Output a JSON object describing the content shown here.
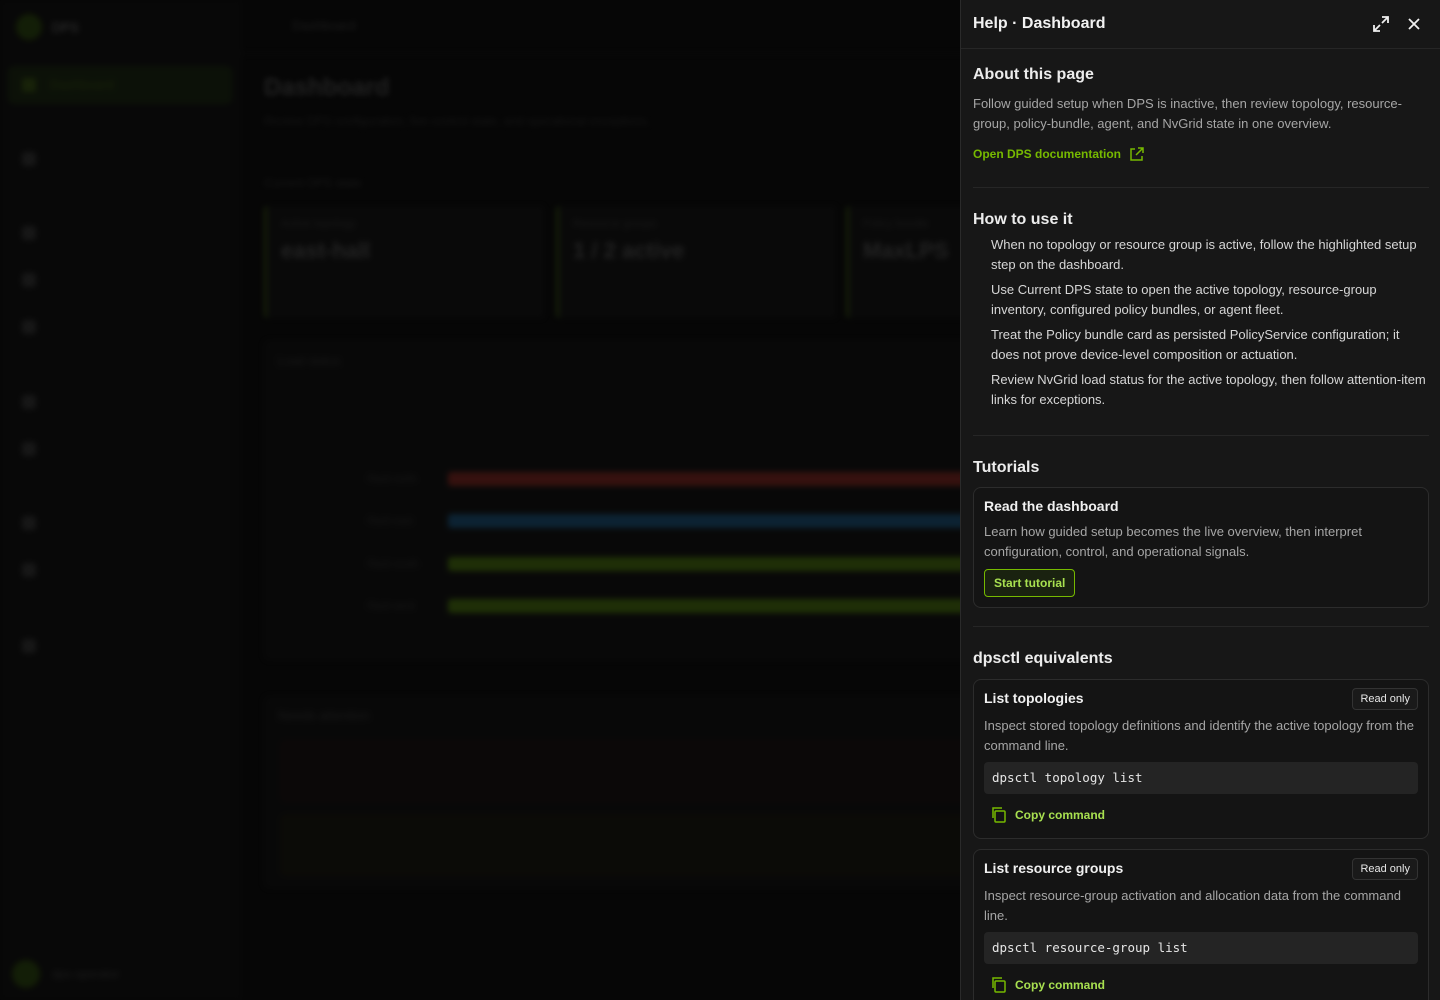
{
  "background": {
    "brand": "DPS",
    "nav_active": "Dashboard",
    "topbar_text": "Dashboard",
    "page_title": "Dashboard",
    "page_subtitle": "Review DPS configuration, live control state, and operational exceptions.",
    "section_label": "Current DPS state",
    "cards": [
      {
        "label": "Active topology",
        "value": "east-hall"
      },
      {
        "label": "Resource groups",
        "value": "1 / 2 active"
      },
      {
        "label": "Policy bundle",
        "value": "MaxLPS"
      }
    ],
    "chart_title": "Load status",
    "bars": [
      {
        "label": "Rack north",
        "color": "#8f2a22"
      },
      {
        "label": "Rack east",
        "color": "#1c5a86"
      },
      {
        "label": "Rack south",
        "color": "#4f7d0e"
      },
      {
        "label": "Rack west",
        "color": "#4f7d0e"
      }
    ],
    "attention_title": "Needs attention",
    "user": "dps operator"
  },
  "panel": {
    "title": "Help · Dashboard",
    "about": {
      "title": "About this page",
      "text": "Follow guided setup when DPS is inactive, then review topology, resource-group, policy-bundle, agent, and NvGrid state in one overview.",
      "link": "Open DPS documentation"
    },
    "how": {
      "title": "How to use it",
      "steps": [
        "When no topology or resource group is active, follow the highlighted setup step on the dashboard.",
        "Use Current DPS state to open the active topology, resource-group inventory, configured policy bundles, or agent fleet.",
        "Treat the Policy bundle card as persisted PolicyService configuration; it does not prove device-level composition or actuation.",
        "Review NvGrid load status for the active topology, then follow attention-item links for exceptions."
      ]
    },
    "tutorials": {
      "title": "Tutorials",
      "card_title": "Read the dashboard",
      "card_text": "Learn how guided setup becomes the live overview, then interpret configuration, control, and operational signals.",
      "button": "Start tutorial"
    },
    "dpsctl": {
      "title": "dpsctl equivalents",
      "commands": [
        {
          "title": "List topologies",
          "badge": "Read only",
          "text": "Inspect stored topology definitions and identify the active topology from the command line.",
          "code": "dpsctl topology list",
          "copy": "Copy command"
        },
        {
          "title": "List resource groups",
          "badge": "Read only",
          "text": "Inspect resource-group activation and allocation data from the command line.",
          "code": "dpsctl resource-group list",
          "copy": "Copy command"
        }
      ]
    }
  },
  "colors": {
    "accent": "#76b900",
    "panel_bg": "#171717"
  }
}
